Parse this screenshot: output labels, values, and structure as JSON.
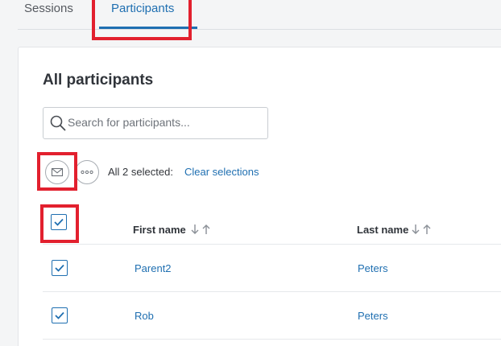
{
  "tabs": [
    {
      "label": "Sessions"
    },
    {
      "label": "Participants",
      "active": true
    }
  ],
  "card": {
    "title": "All participants",
    "search": {
      "placeholder": "Search for participants...",
      "value": ""
    },
    "actions": {
      "email_icon": "envelope-icon",
      "more_icon": "ellipsis-icon",
      "selection_text": "All 2 selected:",
      "clear_label": "Clear selections"
    },
    "table": {
      "headers": {
        "first_name": "First name",
        "last_name": "Last name"
      },
      "select_all_checked": true,
      "rows": [
        {
          "first_name": "Parent2",
          "last_name": "Peters",
          "checked": true
        },
        {
          "first_name": "Rob",
          "last_name": "Peters",
          "checked": true
        }
      ]
    }
  },
  "colors": {
    "accent": "#1f6fb1",
    "highlight": "#e2202e"
  }
}
